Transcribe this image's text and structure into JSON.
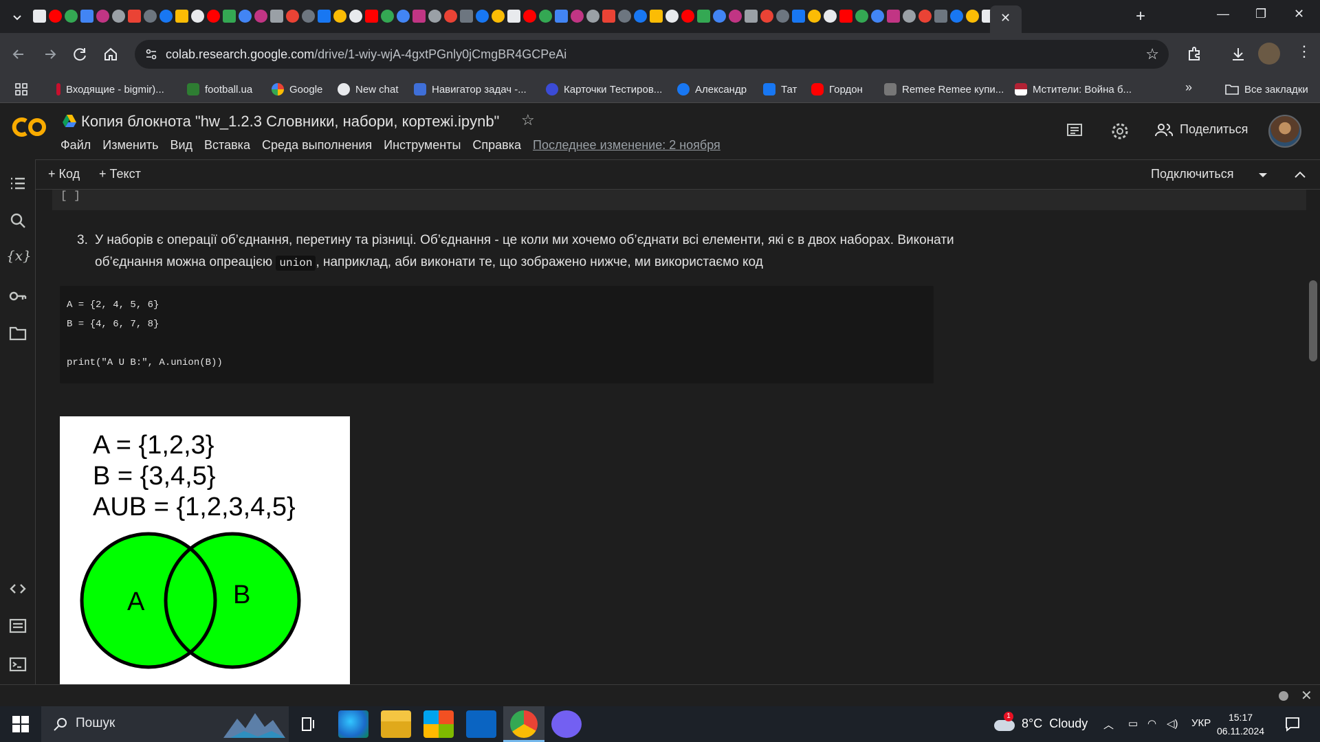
{
  "browser": {
    "url_domain": "colab.research.google.com",
    "url_path": "/drive/1-wiy-wjA-4gxtPGnly0jCmgBR4GCPeAi",
    "bookmarks": [
      "Входящие - bigmir)...",
      "football.ua",
      "Google",
      "New chat",
      "Навигатор задач -...",
      "Карточки Тестиров...",
      "Александр",
      "Тат",
      "Гордон",
      "Remee Remee купи...",
      "Мстители: Война б..."
    ],
    "all_bookmarks": "Все закладки"
  },
  "colab": {
    "title": "Копия блокнота \"hw_1.2.3 Словники, набори, кортежі.ipynb\"",
    "menu": [
      "Файл",
      "Изменить",
      "Вид",
      "Вставка",
      "Среда выполнения",
      "Инструменты",
      "Справка"
    ],
    "last_edit": "Последнее изменение: 2 ноября",
    "share": "Поделиться",
    "add_code": "+ Код",
    "add_text": "+ Текст",
    "connect": "Подключиться"
  },
  "cell": {
    "prev_cell_marker": "[ ]",
    "item_number": "3.",
    "text_part1": "У наборів є операції об’єднання, перетину та різниці. Об’єднання - це коли ми хочемо об’єднати всі елементи, які є в двох наборах. Виконати об’єднання можна опреацією",
    "inline_code": "union",
    "text_part2": ", наприклад, аби виконати те, що зображено нижче, ми використаємо код",
    "code_line1": "A = {2, 4, 5, 6}",
    "code_line2": "B = {4, 6, 7, 8}",
    "code_line3": "",
    "code_line4": "print(\"A U B:\", A.union(B))"
  },
  "venn_image": {
    "line1": "A = {1,2,3}",
    "line2": "B = {3,4,5}",
    "line3": "AUB = {1,2,3,4,5}",
    "label_a": "A",
    "label_b": "B",
    "fill_color": "#00ff00"
  },
  "taskbar": {
    "search": "Пошук",
    "weather_temp": "8°C",
    "weather_desc": "Cloudy",
    "weather_badge": "1",
    "lang": "УКР",
    "time": "15:17",
    "date": "06.11.2024"
  },
  "colors": {
    "accent_orange": "#f9ab00",
    "bg_dark": "#1e1e1e"
  }
}
